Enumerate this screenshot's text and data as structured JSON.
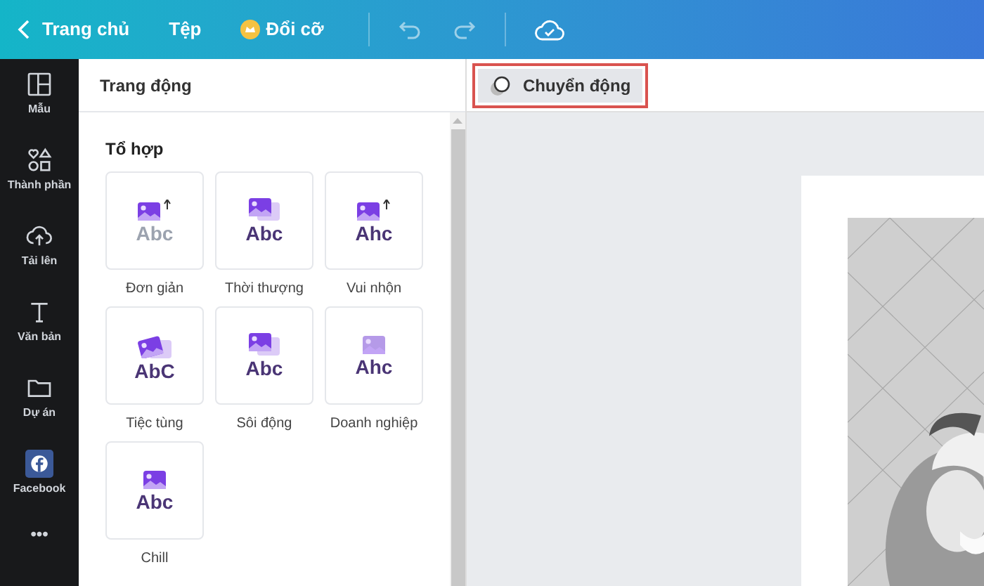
{
  "topbar": {
    "back": "Trang chủ",
    "file": "Tệp",
    "resize": "Đổi cỡ"
  },
  "sidebar": {
    "items": [
      {
        "label": "Mẫu"
      },
      {
        "label": "Thành phần"
      },
      {
        "label": "Tải lên"
      },
      {
        "label": "Văn bản"
      },
      {
        "label": "Dự án"
      },
      {
        "label": "Facebook"
      },
      {
        "label": "•••"
      }
    ]
  },
  "panel": {
    "title": "Trang động",
    "section": "Tổ hợp",
    "items": [
      {
        "label": "Đơn giản",
        "sample": "Abc"
      },
      {
        "label": "Thời thượng",
        "sample": "Abc"
      },
      {
        "label": "Vui nhộn",
        "sample": "Ahc"
      },
      {
        "label": "Tiệc tùng",
        "sample": "AbC"
      },
      {
        "label": "Sôi động",
        "sample": "Abc"
      },
      {
        "label": "Doanh nghiệp",
        "sample": "Ahc"
      },
      {
        "label": "Chill",
        "sample": "Abc"
      }
    ]
  },
  "toolbar": {
    "animate_button": "Chuyển động"
  }
}
